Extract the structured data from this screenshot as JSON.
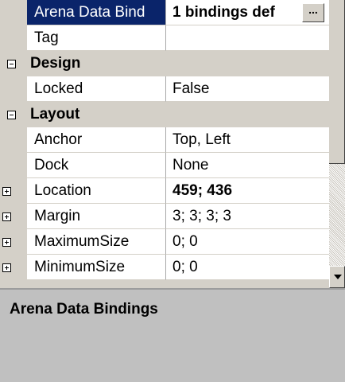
{
  "property_grid": {
    "rows": {
      "arena_data_bindings": {
        "name": "Arena Data Bind",
        "value": "1 bindings def",
        "button": "..."
      },
      "tag": {
        "name": "Tag",
        "value": ""
      },
      "locked": {
        "name": "Locked",
        "value": "False"
      },
      "anchor": {
        "name": "Anchor",
        "value": "Top, Left"
      },
      "dock": {
        "name": "Dock",
        "value": "None"
      },
      "location": {
        "name": "Location",
        "value": "459; 436"
      },
      "margin": {
        "name": "Margin",
        "value": "3; 3; 3; 3"
      },
      "maximum_size": {
        "name": "MaximumSize",
        "value": "0; 0"
      },
      "minimum_size": {
        "name": "MinimumSize",
        "value": "0; 0"
      }
    },
    "categories": {
      "design": "Design",
      "layout": "Layout"
    }
  },
  "description": {
    "title": "Arena Data Bindings"
  },
  "colors": {
    "selection": "#0a246a",
    "panel": "#d4d0c8",
    "description_bg": "#c0c0c0"
  }
}
